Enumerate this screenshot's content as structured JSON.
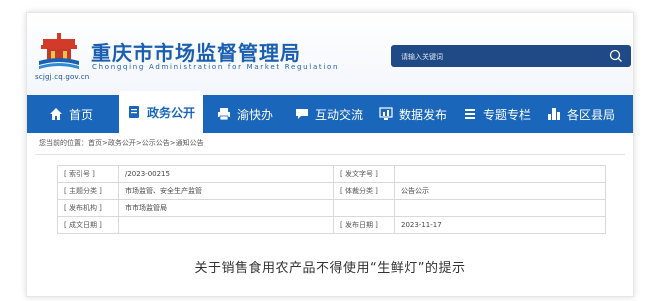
{
  "header": {
    "title": "重庆市市场监督管理局",
    "subtitle": "Chongqing  Administration for Market Regulation",
    "domain": "scjgj.cq.gov.cn",
    "search_placeholder": "请输入关键词"
  },
  "nav": {
    "items": [
      {
        "label": "首页",
        "icon": "home-icon"
      },
      {
        "label": "政务公开",
        "icon": "document-icon",
        "active": true
      },
      {
        "label": "渝快办",
        "icon": "printer-icon"
      },
      {
        "label": "互动交流",
        "icon": "chat-icon"
      },
      {
        "label": "数据发布",
        "icon": "chart-icon"
      },
      {
        "label": "专题专栏",
        "icon": "list-icon"
      },
      {
        "label": "各区县局",
        "icon": "building-icon"
      }
    ]
  },
  "breadcrumb": "您当前的位置：首页>政务公开>公示公告>通知公告",
  "info_table": {
    "rows": [
      [
        {
          "label": "[ 索引号 ]",
          "value": "/2023-00215"
        },
        {
          "label": "[ 发文字号 ]",
          "value": ""
        }
      ],
      [
        {
          "label": "[ 主题分类 ]",
          "value": "市场监管、安全生产监管"
        },
        {
          "label": "[ 体裁分类 ]",
          "value": "公告公示"
        }
      ],
      [
        {
          "label": "[ 发布机构 ]",
          "value": "市市场监管局"
        },
        {
          "label": "",
          "value": ""
        }
      ],
      [
        {
          "label": "[ 成文日期 ]",
          "value": ""
        },
        {
          "label": "[ 发布日期 ]",
          "value": "2023-11-17"
        }
      ]
    ]
  },
  "document_title": "关于销售食用农产品不得使用“生鲜灯”的提示",
  "colors": {
    "brand": "#1a66bb",
    "search_bg": "#1f4a85"
  }
}
